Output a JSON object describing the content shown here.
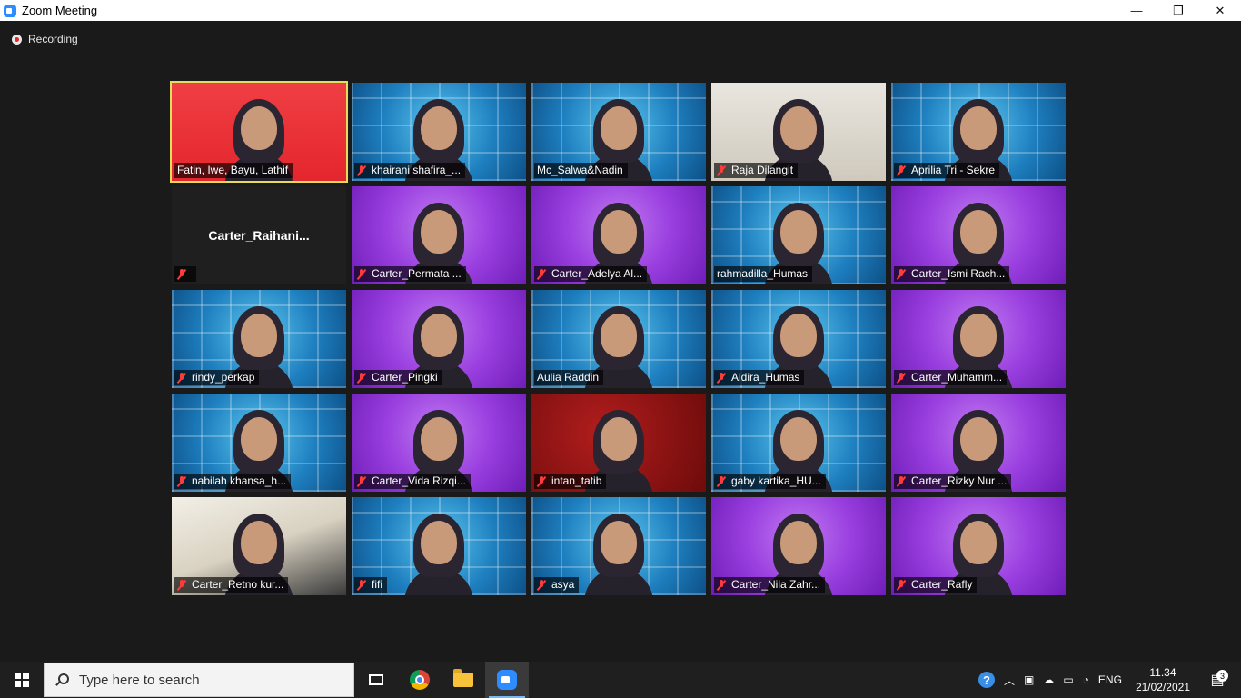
{
  "window": {
    "title": "Zoom Meeting",
    "minimize": "—",
    "maximize": "❐",
    "close": "✕"
  },
  "meeting": {
    "recording_label": "Recording",
    "participants": [
      {
        "name": "Fatin, Iwe, Bayu, Lathif",
        "bg": "red",
        "active": true,
        "muted": false
      },
      {
        "name": "khairani shafira_...",
        "bg": "blue",
        "muted": true
      },
      {
        "name": "Mc_Salwa&Nadin",
        "bg": "blue",
        "muted": false
      },
      {
        "name": "Raja Dilangit",
        "bg": "photo",
        "muted": true
      },
      {
        "name": "Aprilia Tri - Sekre",
        "bg": "blue",
        "muted": true
      },
      {
        "name": "",
        "display": "Carter_Raihani...",
        "bg": "dark",
        "muted": true
      },
      {
        "name": "Carter_Permata ...",
        "bg": "purple",
        "muted": true
      },
      {
        "name": "Carter_Adelya Al...",
        "bg": "purple",
        "muted": true
      },
      {
        "name": "rahmadilla_Humas",
        "bg": "blue",
        "muted": false
      },
      {
        "name": "Carter_Ismi Rach...",
        "bg": "purple",
        "muted": true
      },
      {
        "name": "rindy_perkap",
        "bg": "blue",
        "muted": true
      },
      {
        "name": "Carter_Pingki",
        "bg": "purple",
        "muted": true
      },
      {
        "name": "Aulia Raddin",
        "bg": "blue",
        "muted": false
      },
      {
        "name": "Aldira_Humas",
        "bg": "blue",
        "muted": true
      },
      {
        "name": "Carter_Muhamm...",
        "bg": "purple",
        "muted": true
      },
      {
        "name": "nabilah khansa_h...",
        "bg": "blue",
        "muted": true
      },
      {
        "name": "Carter_Vida Rizqi...",
        "bg": "purple",
        "muted": true
      },
      {
        "name": "intan_tatib",
        "bg": "darkred",
        "muted": true
      },
      {
        "name": "gaby kartika_HU...",
        "bg": "blue",
        "muted": true
      },
      {
        "name": "Carter_Rizky Nur ...",
        "bg": "purple",
        "muted": true
      },
      {
        "name": "Carter_Retno kur...",
        "bg": "room",
        "muted": true
      },
      {
        "name": "fifi",
        "bg": "blue",
        "muted": true
      },
      {
        "name": "asya",
        "bg": "blue",
        "muted": true
      },
      {
        "name": "Carter_Nila Zahr...",
        "bg": "purple",
        "muted": true
      },
      {
        "name": "Carter_Rafly",
        "bg": "purple",
        "muted": true
      }
    ]
  },
  "taskbar": {
    "search_placeholder": "Type here to search",
    "apps": [
      {
        "icon": "task-view-icon"
      },
      {
        "icon": "chrome-icon"
      },
      {
        "icon": "file-explorer-icon"
      },
      {
        "icon": "zoom-icon",
        "active": true
      }
    ],
    "tray": {
      "help": "?",
      "language": "ENG",
      "time": "11.34",
      "date": "21/02/2021",
      "notification_count": "3"
    }
  },
  "colors": {
    "accent_active_speaker": "#e6dc5a",
    "muted_red": "#ff3b3b",
    "zoom_blue": "#2d8cff"
  }
}
